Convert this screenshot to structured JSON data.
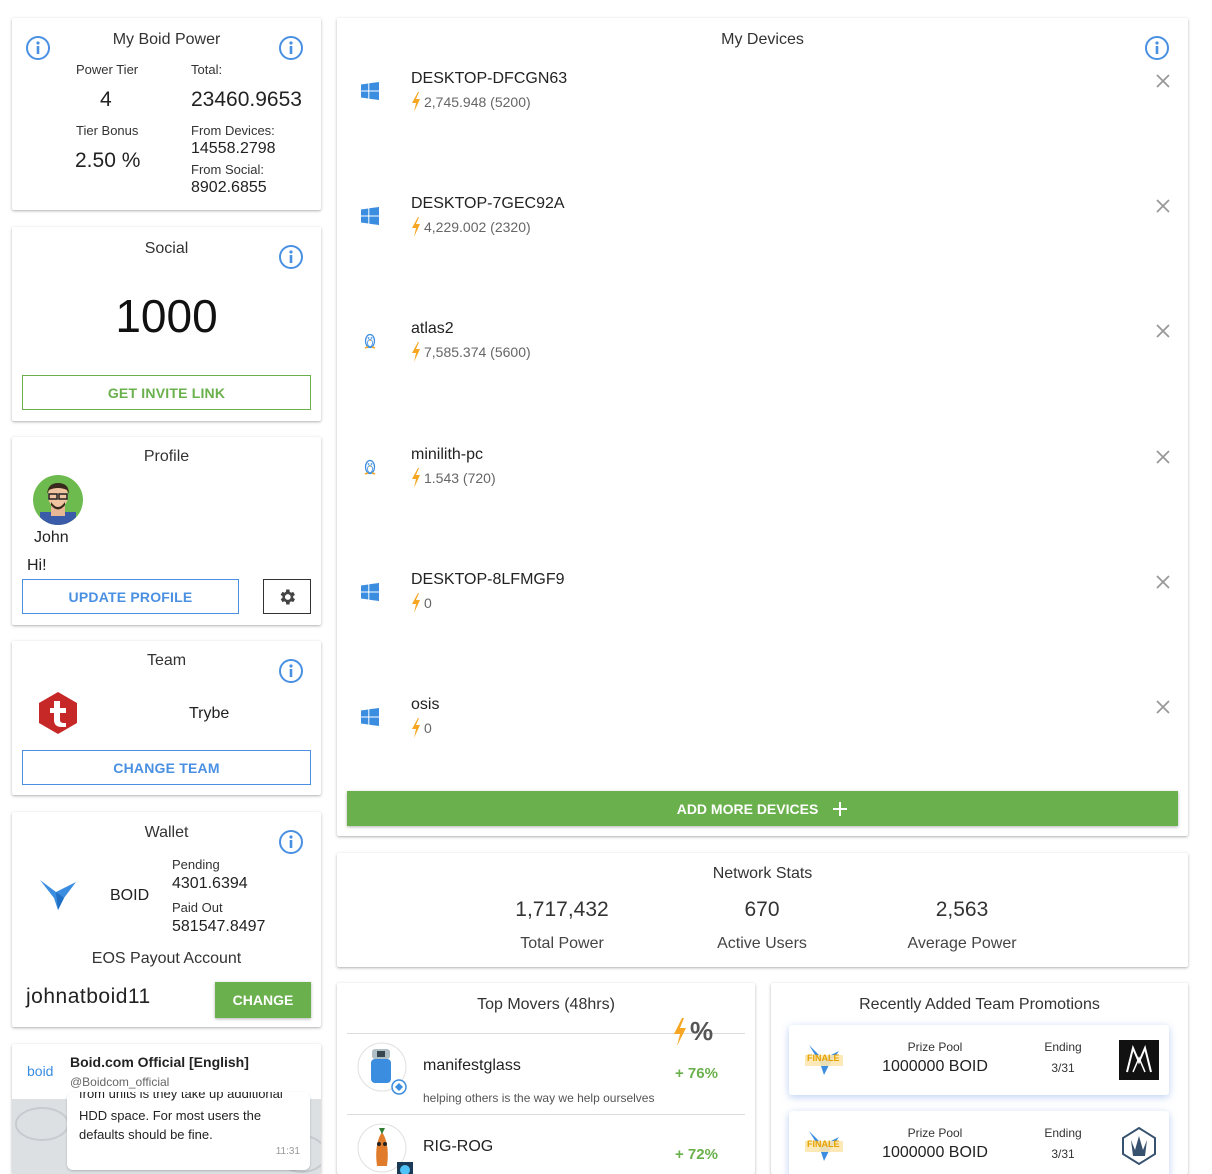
{
  "boid_power": {
    "title": "My Boid Power",
    "power_tier_label": "Power Tier",
    "power_tier": "4",
    "total_label": "Total:",
    "total": "23460.9653",
    "tier_bonus_label": "Tier Bonus",
    "tier_bonus": "2.50 %",
    "from_devices_label": "From Devices:",
    "from_devices": "14558.2798",
    "from_social_label": "From Social:",
    "from_social": "8902.6855"
  },
  "social": {
    "title": "Social",
    "value": "1000",
    "invite_button": "GET INVITE LINK"
  },
  "profile": {
    "title": "Profile",
    "name": "John",
    "greeting": "Hi!",
    "update_button": "UPDATE PROFILE"
  },
  "team": {
    "title": "Team",
    "name": "Trybe",
    "change_button": "CHANGE TEAM"
  },
  "wallet": {
    "title": "Wallet",
    "token": "BOID",
    "pending_label": "Pending",
    "pending": "4301.6394",
    "paid_out_label": "Paid Out",
    "paid_out": "581547.8497",
    "payout_label": "EOS Payout Account",
    "payout_account": "johnatboid11",
    "change_button": "CHANGE"
  },
  "tweet": {
    "logo_text": "boid",
    "account_name": "Boid.com Official [English]",
    "handle": "@Boidcom_official",
    "body_top": "from units is they take up additional",
    "body": "HDD space. For most users the defaults should be fine.",
    "time": "11:31"
  },
  "devices": {
    "title": "My Devices",
    "items": [
      {
        "name": "DESKTOP-DFCGN63",
        "power": "2,745.948 (5200)",
        "os": "windows-icon"
      },
      {
        "name": "DESKTOP-7GEC92A",
        "power": "4,229.002 (2320)",
        "os": "windows-icon"
      },
      {
        "name": "atlas2",
        "power": "7,585.374 (5600)",
        "os": "linux-icon"
      },
      {
        "name": "minilith-pc",
        "power": "1.543 (720)",
        "os": "linux-icon"
      },
      {
        "name": "DESKTOP-8LFMGF9",
        "power": "0",
        "os": "windows-icon"
      },
      {
        "name": "osis",
        "power": "0",
        "os": "windows-icon"
      }
    ],
    "add_button": "ADD MORE DEVICES"
  },
  "network": {
    "title": "Network Stats",
    "total_power": "1,717,432",
    "total_power_label": "Total Power",
    "active_users": "670",
    "active_users_label": "Active Users",
    "average_power": "2,563",
    "average_power_label": "Average Power"
  },
  "movers": {
    "title": "Top Movers (48hrs)",
    "percent_symbol": "%",
    "items": [
      {
        "name": "manifestglass",
        "tagline": "helping others is the way we help ourselves",
        "change": "+ 76%"
      },
      {
        "name": "RIG-ROG",
        "tagline": "",
        "change": "+ 72%"
      }
    ]
  },
  "promotions": {
    "title": "Recently Added Team Promotions",
    "items": [
      {
        "badge": "FINALE",
        "prize_label": "Prize Pool",
        "prize": "1000000 BOID",
        "ending_label": "Ending",
        "ending": "3/31"
      },
      {
        "badge": "FINALE",
        "prize_label": "Prize Pool",
        "prize": "1000000 BOID",
        "ending_label": "Ending",
        "ending": "3/31"
      }
    ]
  },
  "colors": {
    "accent_blue": "#4a90e2",
    "accent_green": "#6ab04c",
    "bolt_orange": "#f5a623",
    "team_red": "#c62828"
  }
}
